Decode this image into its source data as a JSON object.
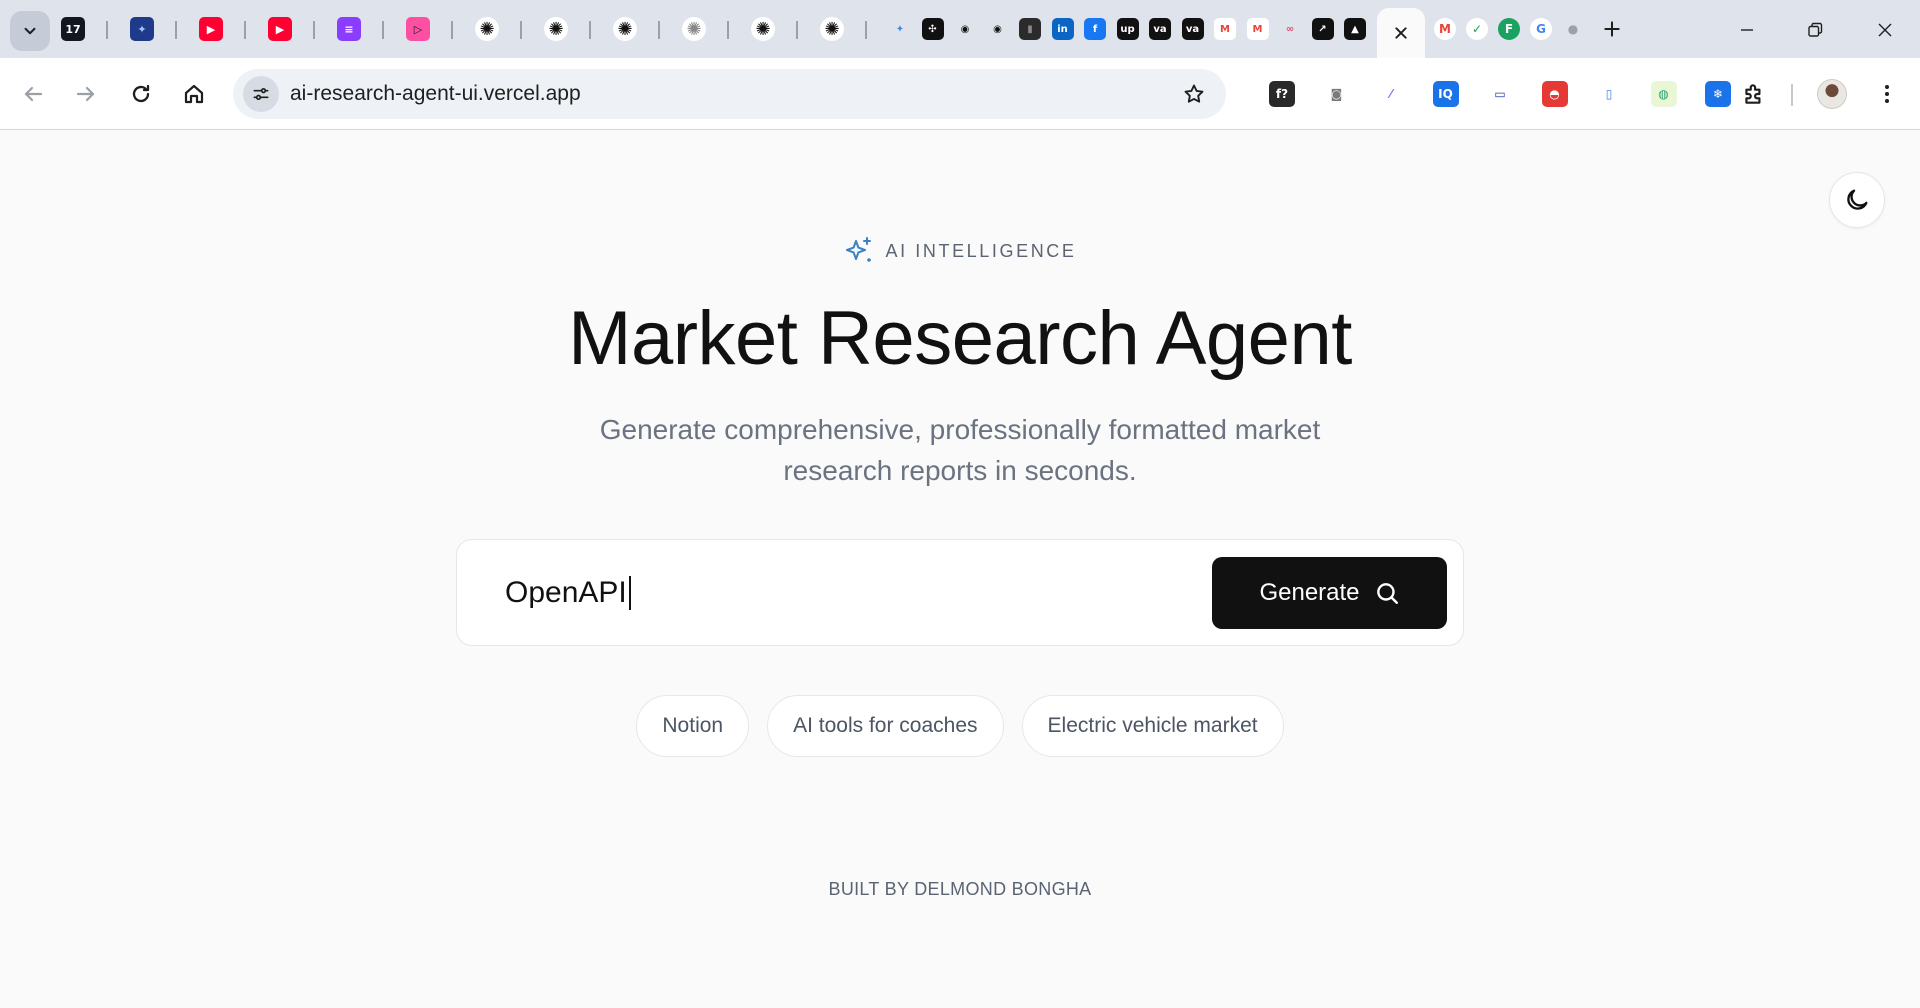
{
  "browser": {
    "url": "ai-research-agent-ui.vercel.app",
    "tabs": [
      {
        "icon": "tradingview-icon",
        "glyph": "17",
        "bg": "#131722",
        "fg": "#ffffff"
      },
      {
        "icon": "blue-app-icon",
        "glyph": "✦",
        "bg": "#1f3a8a",
        "fg": "#9ec5ff"
      },
      {
        "icon": "youtube-icon",
        "glyph": "▶",
        "bg": "#ff0033",
        "fg": "#ffffff"
      },
      {
        "icon": "youtube-icon",
        "glyph": "▶",
        "bg": "#ff0033",
        "fg": "#ffffff"
      },
      {
        "icon": "stack-app-icon",
        "glyph": "≡",
        "bg": "#8b3dff",
        "fg": "#ffffff"
      },
      {
        "icon": "pink-play-icon",
        "glyph": "▷",
        "bg": "#ff4fa3",
        "fg": "#1a1a1a"
      },
      {
        "icon": "openai-icon",
        "glyph": "✺",
        "bg": "#ffffff",
        "fg": "#111111"
      },
      {
        "icon": "openai-icon",
        "glyph": "✺",
        "bg": "#ffffff",
        "fg": "#111111"
      },
      {
        "icon": "openai-icon",
        "glyph": "✺",
        "bg": "#ffffff",
        "fg": "#111111"
      },
      {
        "icon": "openai-icon",
        "glyph": "✺",
        "bg": "#ffffff",
        "fg": "#888888"
      },
      {
        "icon": "openai-icon",
        "glyph": "✺",
        "bg": "#ffffff",
        "fg": "#111111"
      },
      {
        "icon": "openai-icon",
        "glyph": "✺",
        "bg": "#ffffff",
        "fg": "#111111"
      }
    ],
    "pinned": [
      {
        "icon": "gemini-icon",
        "glyph": "✦",
        "bg": "#dfe3eb",
        "fg": "#4285f4"
      },
      {
        "icon": "terminal-icon",
        "glyph": "✣",
        "bg": "#111111",
        "fg": "#ffffff"
      },
      {
        "icon": "github-icon",
        "glyph": "◉",
        "bg": "#dfe3eb",
        "fg": "#111111"
      },
      {
        "icon": "github-icon",
        "glyph": "◉",
        "bg": "#dfe3eb",
        "fg": "#111111"
      },
      {
        "icon": "profile-photo-icon",
        "glyph": "▮",
        "bg": "#2b2b2b",
        "fg": "#888888"
      },
      {
        "icon": "linkedin-icon",
        "glyph": "in",
        "bg": "#0a66c2",
        "fg": "#ffffff"
      },
      {
        "icon": "facebook-icon",
        "glyph": "f",
        "bg": "#1877f2",
        "fg": "#ffffff"
      },
      {
        "icon": "upwork-icon",
        "glyph": "up",
        "bg": "#111111",
        "fg": "#ffffff"
      },
      {
        "icon": "va-icon",
        "glyph": "va",
        "bg": "#111111",
        "fg": "#ffffff"
      },
      {
        "icon": "va-icon",
        "glyph": "va",
        "bg": "#111111",
        "fg": "#ffffff"
      },
      {
        "icon": "gmail-icon",
        "glyph": "M",
        "bg": "#ffffff",
        "fg": "#ea4335"
      },
      {
        "icon": "gmail-icon",
        "glyph": "M",
        "bg": "#ffffff",
        "fg": "#ea4335"
      },
      {
        "icon": "n8n-icon",
        "glyph": "∞",
        "bg": "#dfe3eb",
        "fg": "#ea4b71"
      },
      {
        "icon": "share-icon",
        "glyph": "↗",
        "bg": "#111111",
        "fg": "#ffffff"
      },
      {
        "icon": "vercel-icon",
        "glyph": "▲",
        "bg": "#111111",
        "fg": "#ffffff"
      }
    ],
    "after_tabs": [
      {
        "icon": "gmail-icon",
        "glyph": "M",
        "bg": "#ffffff",
        "fg": "#ea4335"
      },
      {
        "icon": "check-shield-icon",
        "glyph": "✓",
        "bg": "#ffffff",
        "fg": "#16a34a"
      },
      {
        "icon": "feather-icon",
        "glyph": "F",
        "bg": "#1aa260",
        "fg": "#ffffff"
      },
      {
        "icon": "google-icon",
        "glyph": "G",
        "bg": "#ffffff",
        "fg": "#4285f4"
      },
      {
        "icon": "grey-circle-icon",
        "glyph": "●",
        "bg": "#dfe3eb",
        "fg": "#9aa1ad"
      }
    ],
    "extensions": [
      {
        "icon": "formula-extension-icon",
        "glyph": "f?",
        "bg": "#2a2a2a",
        "fg": "#ffffff"
      },
      {
        "icon": "camera-icon",
        "glyph": "◙",
        "bg": "#ffffff",
        "fg": "#7a7a7a"
      },
      {
        "icon": "eyedropper-icon",
        "glyph": "⁄",
        "bg": "#ffffff",
        "fg": "#6b7cff"
      },
      {
        "icon": "iq-extension-icon",
        "glyph": "IQ",
        "bg": "#1a73e8",
        "fg": "#ffffff"
      },
      {
        "icon": "screen-extension-icon",
        "glyph": "▭",
        "bg": "#ffffff",
        "fg": "#1e40af"
      },
      {
        "icon": "red-extension-icon",
        "glyph": "◓",
        "bg": "#e53935",
        "fg": "#ffffff"
      },
      {
        "icon": "phone-extension-icon",
        "glyph": "▯",
        "bg": "#ffffff",
        "fg": "#3b82f6"
      },
      {
        "icon": "globe-extension-icon",
        "glyph": "◍",
        "bg": "#eaf7d6",
        "fg": "#22a06b"
      },
      {
        "icon": "snowflake-extension-icon",
        "glyph": "❄",
        "bg": "#1a73e8",
        "fg": "#ffffff"
      }
    ]
  },
  "hero": {
    "eyebrow": "AI INTELLIGENCE",
    "title": "Market Research Agent",
    "subtitle": "Generate comprehensive, professionally formatted market research reports in seconds."
  },
  "search": {
    "value": "OpenAPI",
    "button_label": "Generate"
  },
  "suggestions": [
    "Notion",
    "AI tools for coaches",
    "Electric vehicle market"
  ],
  "footer": "BUILT BY DELMOND BONGHA",
  "colors": {
    "accent": "#111111",
    "sparkle": "#3b82c4",
    "muted": "#6b7280"
  }
}
